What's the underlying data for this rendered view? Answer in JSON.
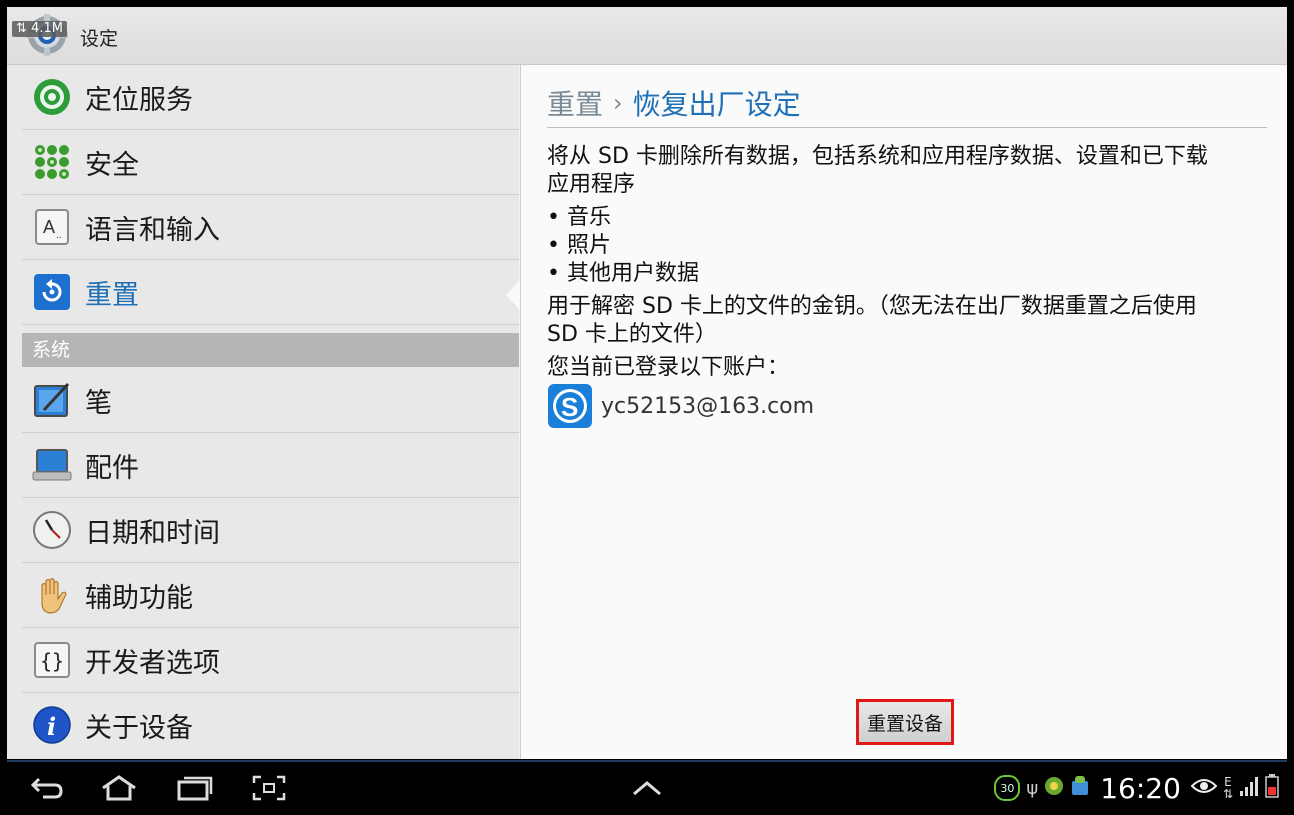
{
  "action_bar": {
    "net_speed": "4.1M",
    "title": "设定"
  },
  "left_menu": {
    "items_top": [
      {
        "label": "定位服务",
        "icon": "location-icon"
      },
      {
        "label": "安全",
        "icon": "security-icon"
      },
      {
        "label": "语言和输入",
        "icon": "language-icon"
      },
      {
        "label": "重置",
        "icon": "reset-icon",
        "selected": true
      }
    ],
    "section_header": "系统",
    "items_system": [
      {
        "label": "笔",
        "icon": "pen-icon"
      },
      {
        "label": "配件",
        "icon": "accessory-icon"
      },
      {
        "label": "日期和时间",
        "icon": "clock-icon"
      },
      {
        "label": "辅助功能",
        "icon": "hand-icon"
      },
      {
        "label": "开发者选项",
        "icon": "developer-icon"
      },
      {
        "label": "关于设备",
        "icon": "info-icon"
      }
    ]
  },
  "detail": {
    "breadcrumb_parent": "重置",
    "breadcrumb_separator": "›",
    "breadcrumb_current": "恢复出厂设定",
    "warning_line1": "将从 SD 卡删除所有数据，包括系统和应用程序数据、设置和已下载",
    "warning_line2": "应用程序",
    "bullets": [
      "• 音乐",
      "• 照片",
      "• 其他用户数据"
    ],
    "key_line1": "用于解密 SD 卡上的文件的金钥。（您无法在出厂数据重置之后使用",
    "key_line2": "SD 卡上的文件）",
    "accounts_heading": "您当前已登录以下账户：",
    "account_email": "yc52153@163.com",
    "reset_button": "重置设备"
  },
  "status_bar": {
    "clock": "16:20",
    "badge_count": "30",
    "network_type": "E"
  },
  "colors": {
    "accent": "#1e6fb5",
    "highlight_border": "#e01818"
  }
}
